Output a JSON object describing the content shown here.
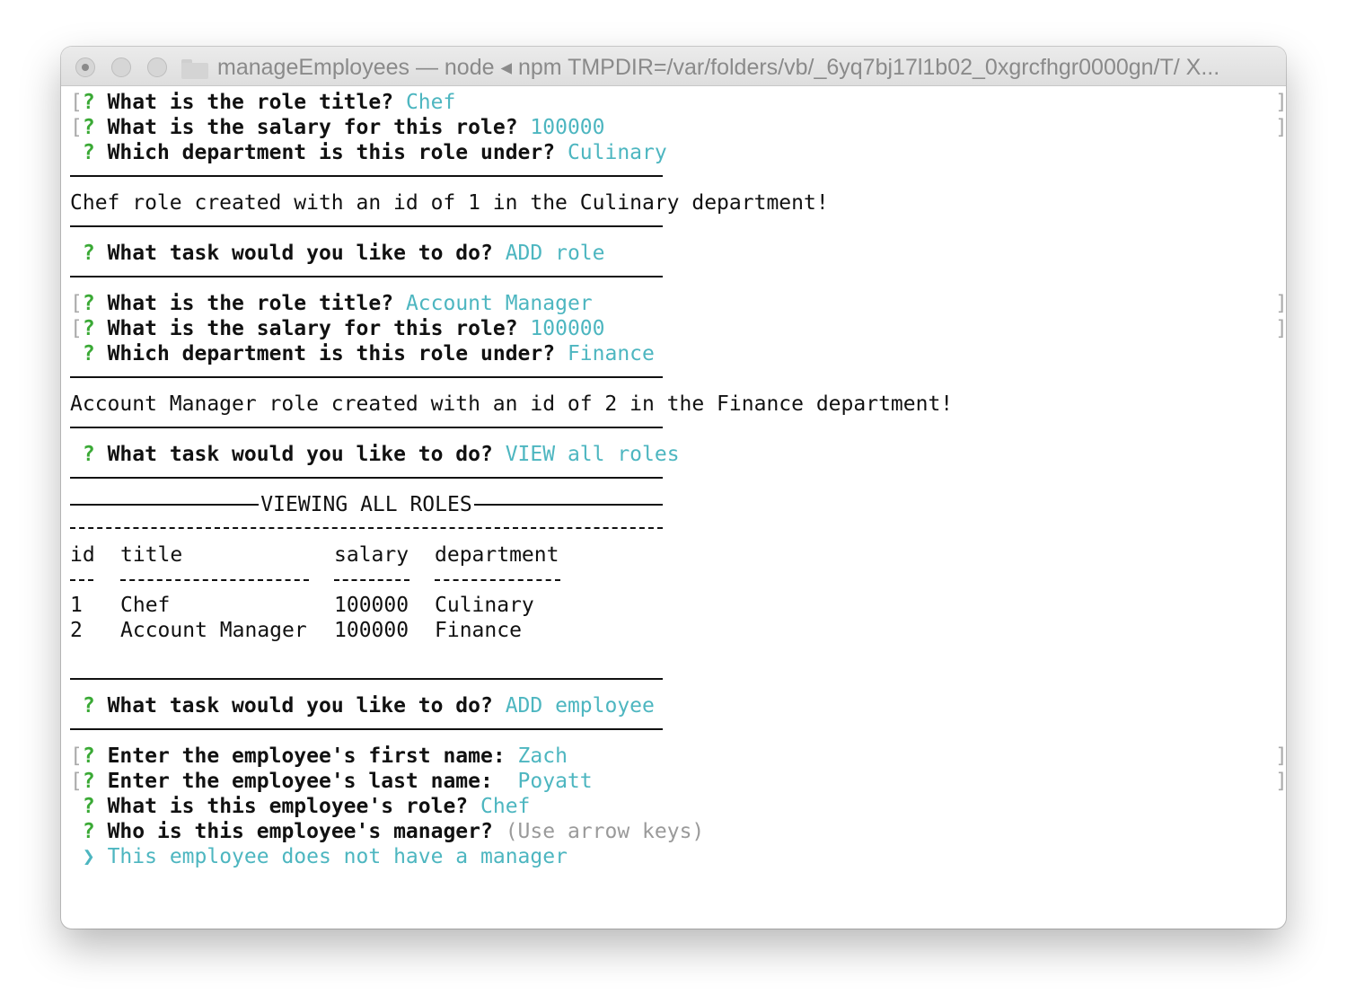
{
  "window": {
    "title": "manageEmployees — node ◂ npm TMPDIR=/var/folders/vb/_6yq7bj17l1b02_0xgrcfhgr0000gn/T/ X..."
  },
  "terminal": {
    "q_mark": "?",
    "bracket_open": "[",
    "bracket_close": "]",
    "block1": {
      "q1": "What is the role title?",
      "a1": "Chef",
      "q2": "What is the salary for this role?",
      "a2": "100000",
      "q3": "Which department is this role under?",
      "a3": "Culinary",
      "result": "Chef role created with an id of 1 in the Culinary department!"
    },
    "task1": {
      "q": "What task would you like to do?",
      "a": "ADD role"
    },
    "block2": {
      "q1": "What is the role title?",
      "a1": "Account Manager",
      "q2": "What is the salary for this role?",
      "a2": "100000",
      "q3": "Which department is this role under?",
      "a3": "Finance",
      "result": "Account Manager role created with an id of 2 in the Finance department!"
    },
    "task2": {
      "q": "What task would you like to do?",
      "a": "VIEW all roles"
    },
    "viewing_banner": "VIEWING ALL ROLES",
    "roles_table": {
      "headers": [
        "id",
        "title",
        "salary",
        "department"
      ],
      "rows": [
        [
          "1",
          "Chef",
          "100000",
          "Culinary"
        ],
        [
          "2",
          "Account Manager",
          "100000",
          "Finance"
        ]
      ]
    },
    "task3": {
      "q": "What task would you like to do?",
      "a": "ADD employee"
    },
    "employee": {
      "q1": "Enter the employee's first name:",
      "a1": "Zach",
      "q2": "Enter the employee's last name: ",
      "a2": "Poyatt",
      "q3": "What is this employee's role?",
      "a3": "Chef",
      "q4": "Who is this employee's manager?",
      "hint": "(Use arrow keys)",
      "pointer": "❯",
      "selected_option": "This employee does not have a manager"
    }
  },
  "colors": {
    "prompt_green": "#3aa935",
    "answer_cyan": "#4db6c0",
    "hint_gray": "#9a9a9a"
  }
}
